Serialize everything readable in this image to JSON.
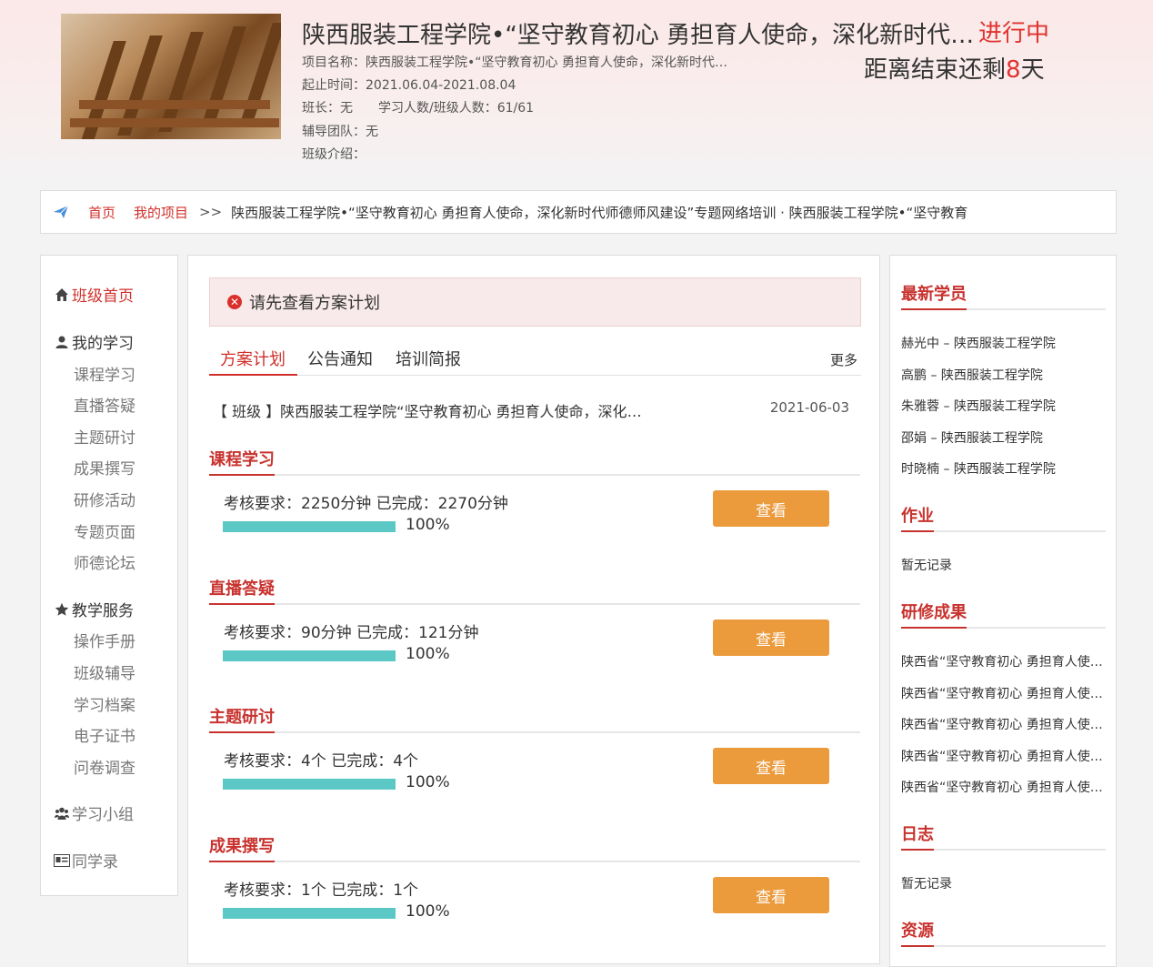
{
  "header": {
    "project_title": "陕西服装工程学院•“坚守教育初心 勇担育人使命，深化新时代师德师风建设”专题网络培训",
    "status": "进行中",
    "remaining_prefix": "距离结束还剩",
    "remaining_days": "8",
    "remaining_suffix": "天",
    "info": {
      "name": "项目名称：陕西服装工程学院•“坚守教育初心 勇担育人使命，深化新时代…",
      "period": "起止时间：2021.06.04-2021.08.04",
      "monitor": "班长：无　　学习人数/班级人数：61/61",
      "team": "辅导团队：无",
      "intro": "班级介绍："
    }
  },
  "breadcrumb": {
    "home": "首页",
    "my_projects": "我的项目",
    "separator": ">>",
    "path": "陕西服装工程学院•“坚守教育初心 勇担育人使命，深化新时代师德师风建设”专题网络培训 · 陕西服装工程学院•“坚守教育"
  },
  "sidebar": {
    "class_home": "班级首页",
    "my_study": "我的学习",
    "study_items": [
      "课程学习",
      "直播答疑",
      "主题研讨",
      "成果撰写",
      "研修活动",
      "专题页面",
      "师德论坛"
    ],
    "teaching": "教学服务",
    "teaching_items": [
      "操作手册",
      "班级辅导",
      "学习档案",
      "电子证书",
      "问卷调查"
    ],
    "study_group": "学习小组",
    "classmates": "同学录"
  },
  "main": {
    "alert": "请先查看方案计划",
    "tabs": [
      "方案计划",
      "公告通知",
      "培训简报"
    ],
    "more": "更多",
    "notice": {
      "title": "【 班级 】陕西服装工程学院“坚守教育初心 勇担育人使命，深化新时代师德师风建设”专题网络培训方案",
      "date": "2021-06-03"
    },
    "sections": [
      {
        "label": "课程学习",
        "requirement": "考核要求：2250分钟 已完成：2270分钟",
        "progress": 100,
        "pct_label": "100%",
        "button": "查看"
      },
      {
        "label": "直播答疑",
        "requirement": "考核要求：90分钟 已完成：121分钟",
        "progress": 100,
        "pct_label": "100%",
        "button": "查看"
      },
      {
        "label": "主题研讨",
        "requirement": "考核要求：4个 已完成：4个",
        "progress": 100,
        "pct_label": "100%",
        "button": "查看"
      },
      {
        "label": "成果撰写",
        "requirement": "考核要求：1个 已完成：1个",
        "progress": 100,
        "pct_label": "100%",
        "button": "查看"
      }
    ]
  },
  "right": {
    "new_students_title": "最新学员",
    "new_students": [
      "赫光中 – 陕西服装工程学院",
      "高鹏 – 陕西服装工程学院",
      "朱雅蓉 – 陕西服装工程学院",
      "邵娟 – 陕西服装工程学院",
      "时晓楠 – 陕西服装工程学院"
    ],
    "homework_title": "作业",
    "homework_empty": "暂无记录",
    "results_title": "研修成果",
    "results": [
      "陕西省“坚守教育初心 勇担育人使命”师德师风建设研修成果",
      "陕西省“坚守教育初心 勇担育人使命”师德师风建设研修成果",
      "陕西省“坚守教育初心 勇担育人使命”师德师风建设研修成果",
      "陕西省“坚守教育初心 勇担育人使命”师德师风建设研修成果",
      "陕西省“坚守教育初心 勇担育人使命”师德师风建设研修成果"
    ],
    "journal_title": "日志",
    "journal_empty": "暂无记录",
    "resources_title": "资源"
  },
  "colors": {
    "accent": "#d0302b",
    "button": "#eb9a3c",
    "progress": "#5cc8c6"
  }
}
